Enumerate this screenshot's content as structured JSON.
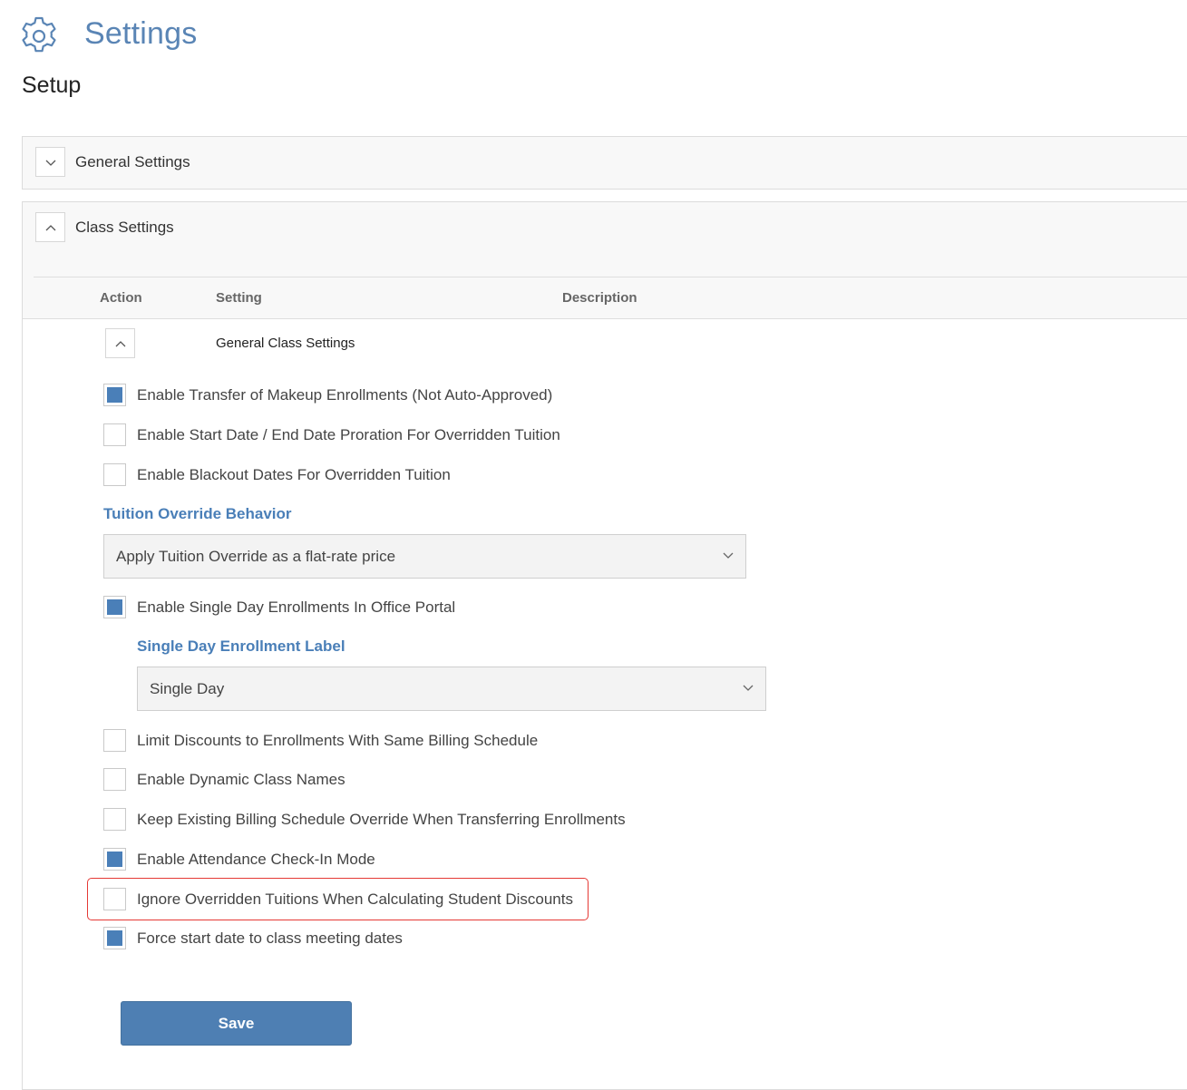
{
  "header": {
    "title": "Settings",
    "subtitle": "Setup",
    "icon": "gear-icon"
  },
  "panels": {
    "general": {
      "label": "General Settings",
      "state": "collapsed"
    },
    "class": {
      "label": "Class Settings",
      "state": "expanded"
    }
  },
  "table_headers": {
    "action": "Action",
    "setting": "Setting",
    "description": "Description"
  },
  "group": {
    "label": "General Class Settings",
    "state": "expanded"
  },
  "options": [
    {
      "label": "Enable Transfer of Makeup Enrollments (Not Auto-Approved)",
      "checked": true
    },
    {
      "label": "Enable Start Date / End Date Proration For Overridden Tuition",
      "checked": false
    },
    {
      "label": "Enable Blackout Dates For Overridden Tuition",
      "checked": false
    },
    {
      "label": "Enable Single Day Enrollments In Office Portal",
      "checked": true
    },
    {
      "label": "Limit Discounts to Enrollments With Same Billing Schedule",
      "checked": false
    },
    {
      "label": "Enable Dynamic Class Names",
      "checked": false
    },
    {
      "label": "Keep Existing Billing Schedule Override When Transferring Enrollments",
      "checked": false
    },
    {
      "label": "Enable Attendance Check-In Mode",
      "checked": true
    },
    {
      "label": "Ignore Overridden Tuitions When Calculating Student Discounts",
      "checked": false
    },
    {
      "label": "Force start date to class meeting dates",
      "checked": true
    }
  ],
  "tuition_override": {
    "label": "Tuition Override Behavior",
    "value": "Apply Tuition Override as a flat-rate price"
  },
  "single_day": {
    "label": "Single Day Enrollment Label",
    "value": "Single Day"
  },
  "save_label": "Save",
  "colors": {
    "accent": "#4a7fb8",
    "title": "#5a85b5",
    "highlight": "#e53935",
    "save_button": "#4e7fb3"
  }
}
